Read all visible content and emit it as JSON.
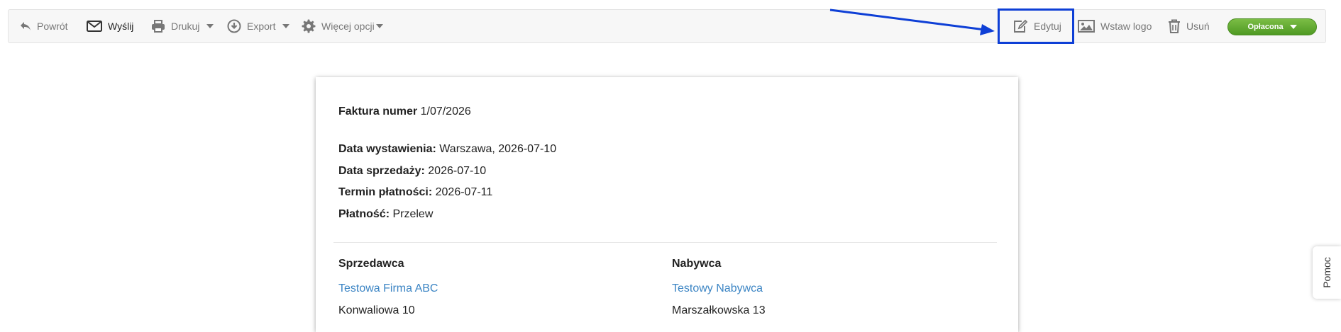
{
  "toolbar": {
    "back_label": "Powrót",
    "send_label": "Wyślij",
    "print_label": "Drukuj",
    "export_label": "Export",
    "more_label": "Więcej opcji",
    "edit_label": "Edytuj",
    "insert_logo_label": "Wstaw logo",
    "delete_label": "Usuń",
    "status_label": "Opłacona"
  },
  "invoice": {
    "number_label": "Faktura numer",
    "number_value": "1/07/2026",
    "issue_date_label": "Data wystawienia:",
    "issue_date_value": "Warszawa, 2026-07-10",
    "sale_date_label": "Data sprzedaży:",
    "sale_date_value": "2026-07-10",
    "due_date_label": "Termin płatności:",
    "due_date_value": "2026-07-11",
    "payment_label": "Płatność:",
    "payment_value": "Przelew",
    "seller": {
      "heading": "Sprzedawca",
      "name": "Testowa Firma ABC",
      "address": "Konwaliowa 10"
    },
    "buyer": {
      "heading": "Nabywca",
      "name": "Testowy Nabywca",
      "address": "Marszałkowska 13"
    }
  },
  "help_tab": {
    "label": "Pomoc"
  },
  "colors": {
    "status_green": "#5aa52b",
    "link_blue": "#3c85c4",
    "annotation_blue": "#0e3fd6"
  }
}
